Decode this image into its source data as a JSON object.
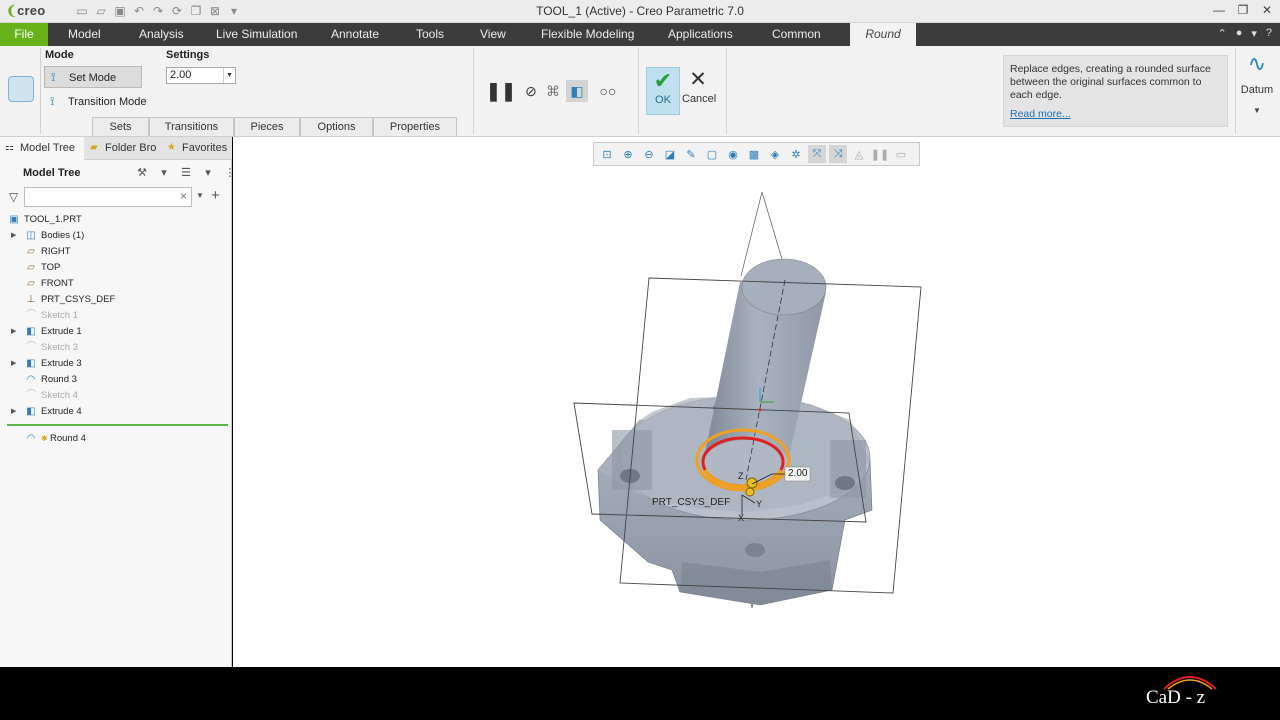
{
  "titlebar": {
    "app_logo": "creo",
    "title": "TOOL_1 (Active) - Creo Parametric 7.0",
    "quick_access_icons": [
      "new-icon",
      "open-icon",
      "save-icon",
      "undo-icon",
      "redo-icon",
      "regenerate-icon",
      "windows-icon",
      "close-window-icon",
      "customize-icon"
    ],
    "window_buttons": [
      "minimize-icon",
      "restore-icon",
      "close-icon"
    ]
  },
  "menubar": {
    "file": "File",
    "tabs": [
      "Model",
      "Analysis",
      "Live Simulation",
      "Annotate",
      "Tools",
      "View",
      "Flexible Modeling",
      "Applications",
      "Common"
    ],
    "active_tab": "Round"
  },
  "ribbon": {
    "mode_label": "Mode",
    "set_mode": "Set Mode",
    "transition_mode": "Transition Mode",
    "settings_label": "Settings",
    "radius_value": "2.00",
    "subtabs": [
      "Sets",
      "Transitions",
      "Pieces",
      "Options",
      "Properties"
    ],
    "controls": [
      "pause-icon",
      "no-preview-icon",
      "attached-preview-icon",
      "verify-mode-icon",
      "glasses-preview-icon"
    ],
    "ok_label": "OK",
    "cancel_label": "Cancel",
    "help_text": "Replace edges, creating a rounded surface between the original surfaces common to each edge.",
    "help_link": "Read more...",
    "datum_label": "Datum"
  },
  "left_panel": {
    "tabs": [
      "Model Tree",
      "Folder Bro",
      "Favorites"
    ],
    "heading": "Model Tree",
    "search_placeholder": "",
    "tree": [
      {
        "label": "TOOL_1.PRT",
        "icon": "part-icon",
        "indent": 0,
        "expandable": false,
        "dim": false
      },
      {
        "label": "Bodies (1)",
        "icon": "bodies-icon",
        "indent": 1,
        "expandable": true,
        "dim": false
      },
      {
        "label": "RIGHT",
        "icon": "datum-plane-icon",
        "indent": 1,
        "expandable": false,
        "dim": false
      },
      {
        "label": "TOP",
        "icon": "datum-plane-icon",
        "indent": 1,
        "expandable": false,
        "dim": false
      },
      {
        "label": "FRONT",
        "icon": "datum-plane-icon",
        "indent": 1,
        "expandable": false,
        "dim": false
      },
      {
        "label": "PRT_CSYS_DEF",
        "icon": "csys-icon",
        "indent": 1,
        "expandable": false,
        "dim": false
      },
      {
        "label": "Sketch 1",
        "icon": "sketch-icon",
        "indent": 1,
        "expandable": false,
        "dim": true
      },
      {
        "label": "Extrude 1",
        "icon": "extrude-icon",
        "indent": 1,
        "expandable": true,
        "dim": false
      },
      {
        "label": "Sketch 3",
        "icon": "sketch-icon",
        "indent": 1,
        "expandable": false,
        "dim": true
      },
      {
        "label": "Extrude 3",
        "icon": "extrude-icon",
        "indent": 1,
        "expandable": true,
        "dim": false
      },
      {
        "label": "Round 3",
        "icon": "round-icon",
        "indent": 1,
        "expandable": false,
        "dim": false
      },
      {
        "label": "Sketch 4",
        "icon": "sketch-icon",
        "indent": 1,
        "expandable": false,
        "dim": true
      },
      {
        "label": "Extrude 4",
        "icon": "extrude-icon",
        "indent": 1,
        "expandable": true,
        "dim": false
      }
    ],
    "inserting_item": "Round 4"
  },
  "graphics": {
    "toolbar_icons": [
      "refit-icon",
      "zoom-in-icon",
      "zoom-out-icon",
      "repaint-icon",
      "perspective-icon",
      "saved-orientations-icon",
      "view-manager-icon",
      "display-style-icon",
      "appearance-icon",
      "datum-display-icon",
      "spin-center-icon",
      "annotation-display-icon",
      "layers-icon",
      "pause-icon",
      "sketch-view-icon"
    ],
    "dimension_label": "2.00",
    "csys_label": "PRT_CSYS_DEF",
    "axis_y": "Y",
    "axis_x": "X",
    "axis_z": "Z"
  },
  "colors": {
    "file_tab": "#67b21b",
    "menubar_bg": "#3c3c3c",
    "part_body": "#9aa4b2",
    "round_preview": "#f0a020",
    "round_edge": "#e02020"
  },
  "branding": "CaD - z"
}
